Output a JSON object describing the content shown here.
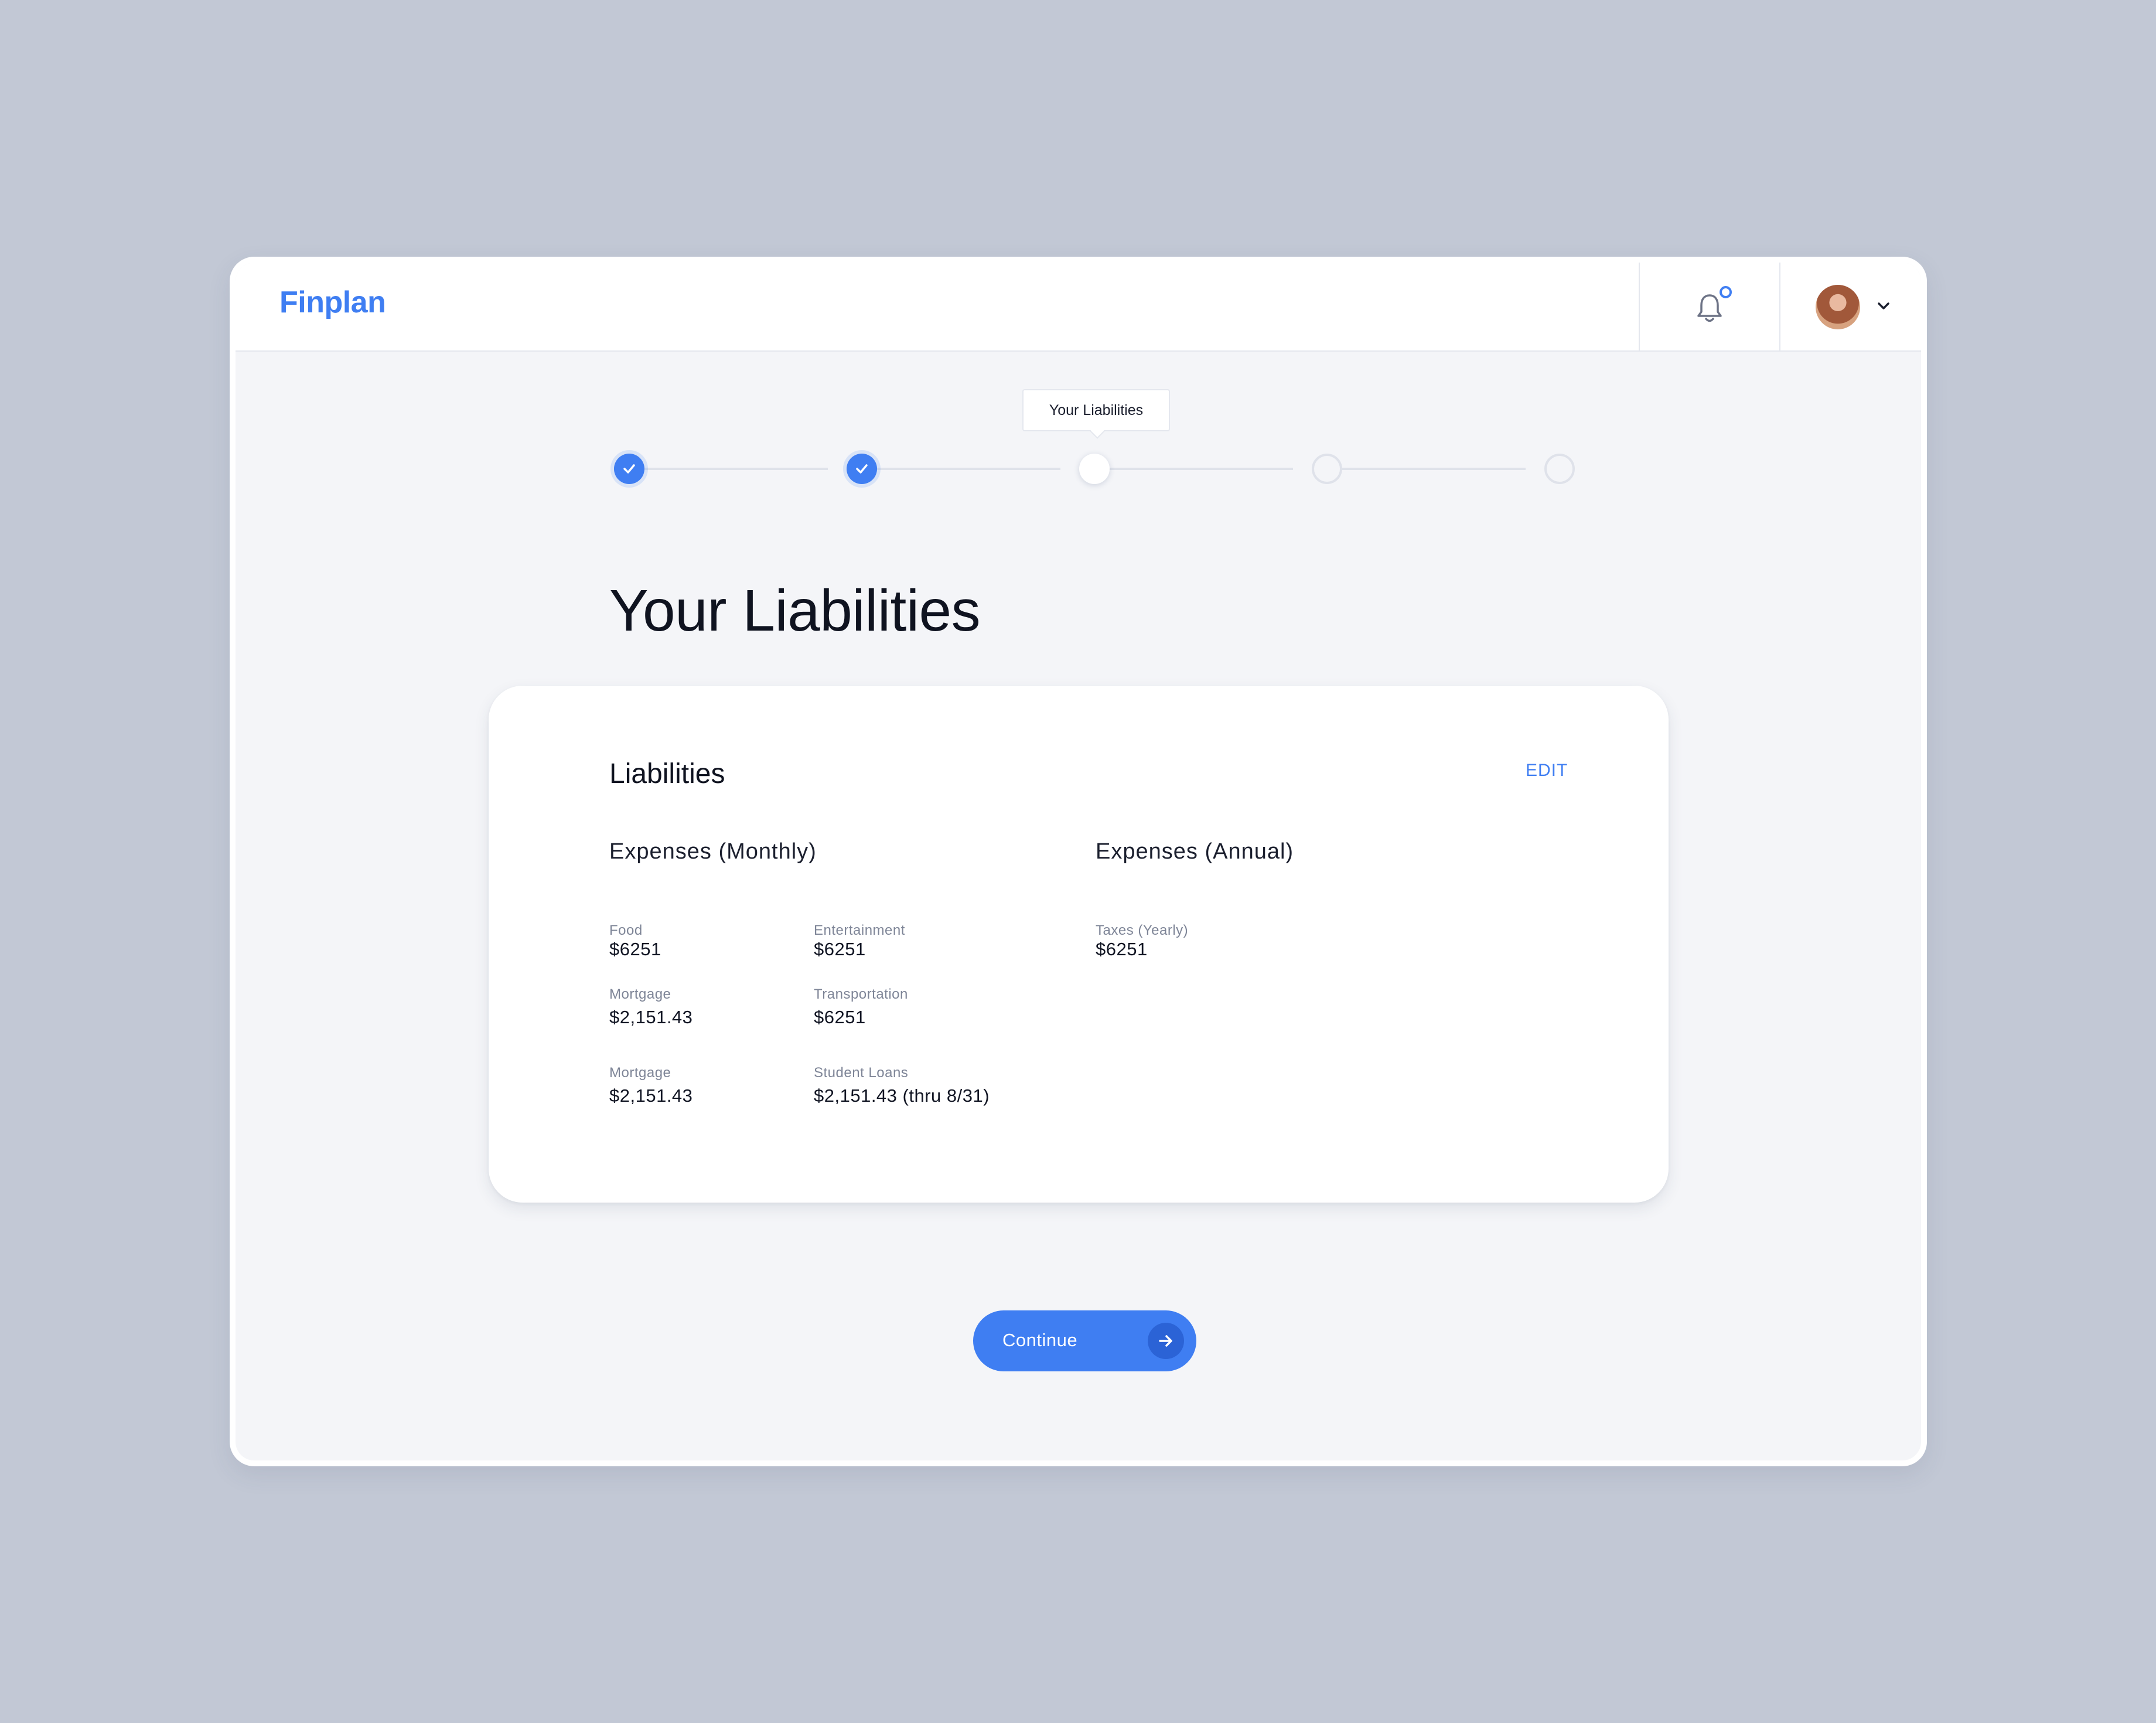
{
  "app": {
    "brand": "Finplan"
  },
  "header": {
    "notifications_icon": "bell-icon",
    "profile_chevron_icon": "chevron-down-icon"
  },
  "stepper": {
    "current_step_tooltip": "Your Liabilities",
    "steps": [
      {
        "state": "completed"
      },
      {
        "state": "completed"
      },
      {
        "state": "current"
      },
      {
        "state": "upcoming"
      },
      {
        "state": "upcoming"
      }
    ]
  },
  "page": {
    "title": "Your Liabilities"
  },
  "card": {
    "title": "Liabilities",
    "edit_label": "EDIT",
    "monthly": {
      "title": "Expenses (Monthly)",
      "items": [
        {
          "label": "Food",
          "value": "$6251"
        },
        {
          "label": "Entertainment",
          "value": "$6251"
        },
        {
          "label": "Mortgage",
          "value": "$2,151.43"
        },
        {
          "label": "Transportation",
          "value": "$6251"
        },
        {
          "label": "Mortgage",
          "value": "$2,151.43"
        },
        {
          "label": "Student Loans",
          "value": "$2,151.43 (thru 8/31)"
        }
      ]
    },
    "annual": {
      "title": "Expenses (Annual)",
      "items": [
        {
          "label": "Taxes (Yearly)",
          "value": "$6251"
        }
      ]
    }
  },
  "continue_button": {
    "label": "Continue",
    "icon": "arrow-right-icon"
  },
  "colors": {
    "accent": "#3f7ef2",
    "background": "#c2c8d5",
    "surface": "#f4f5f8"
  }
}
